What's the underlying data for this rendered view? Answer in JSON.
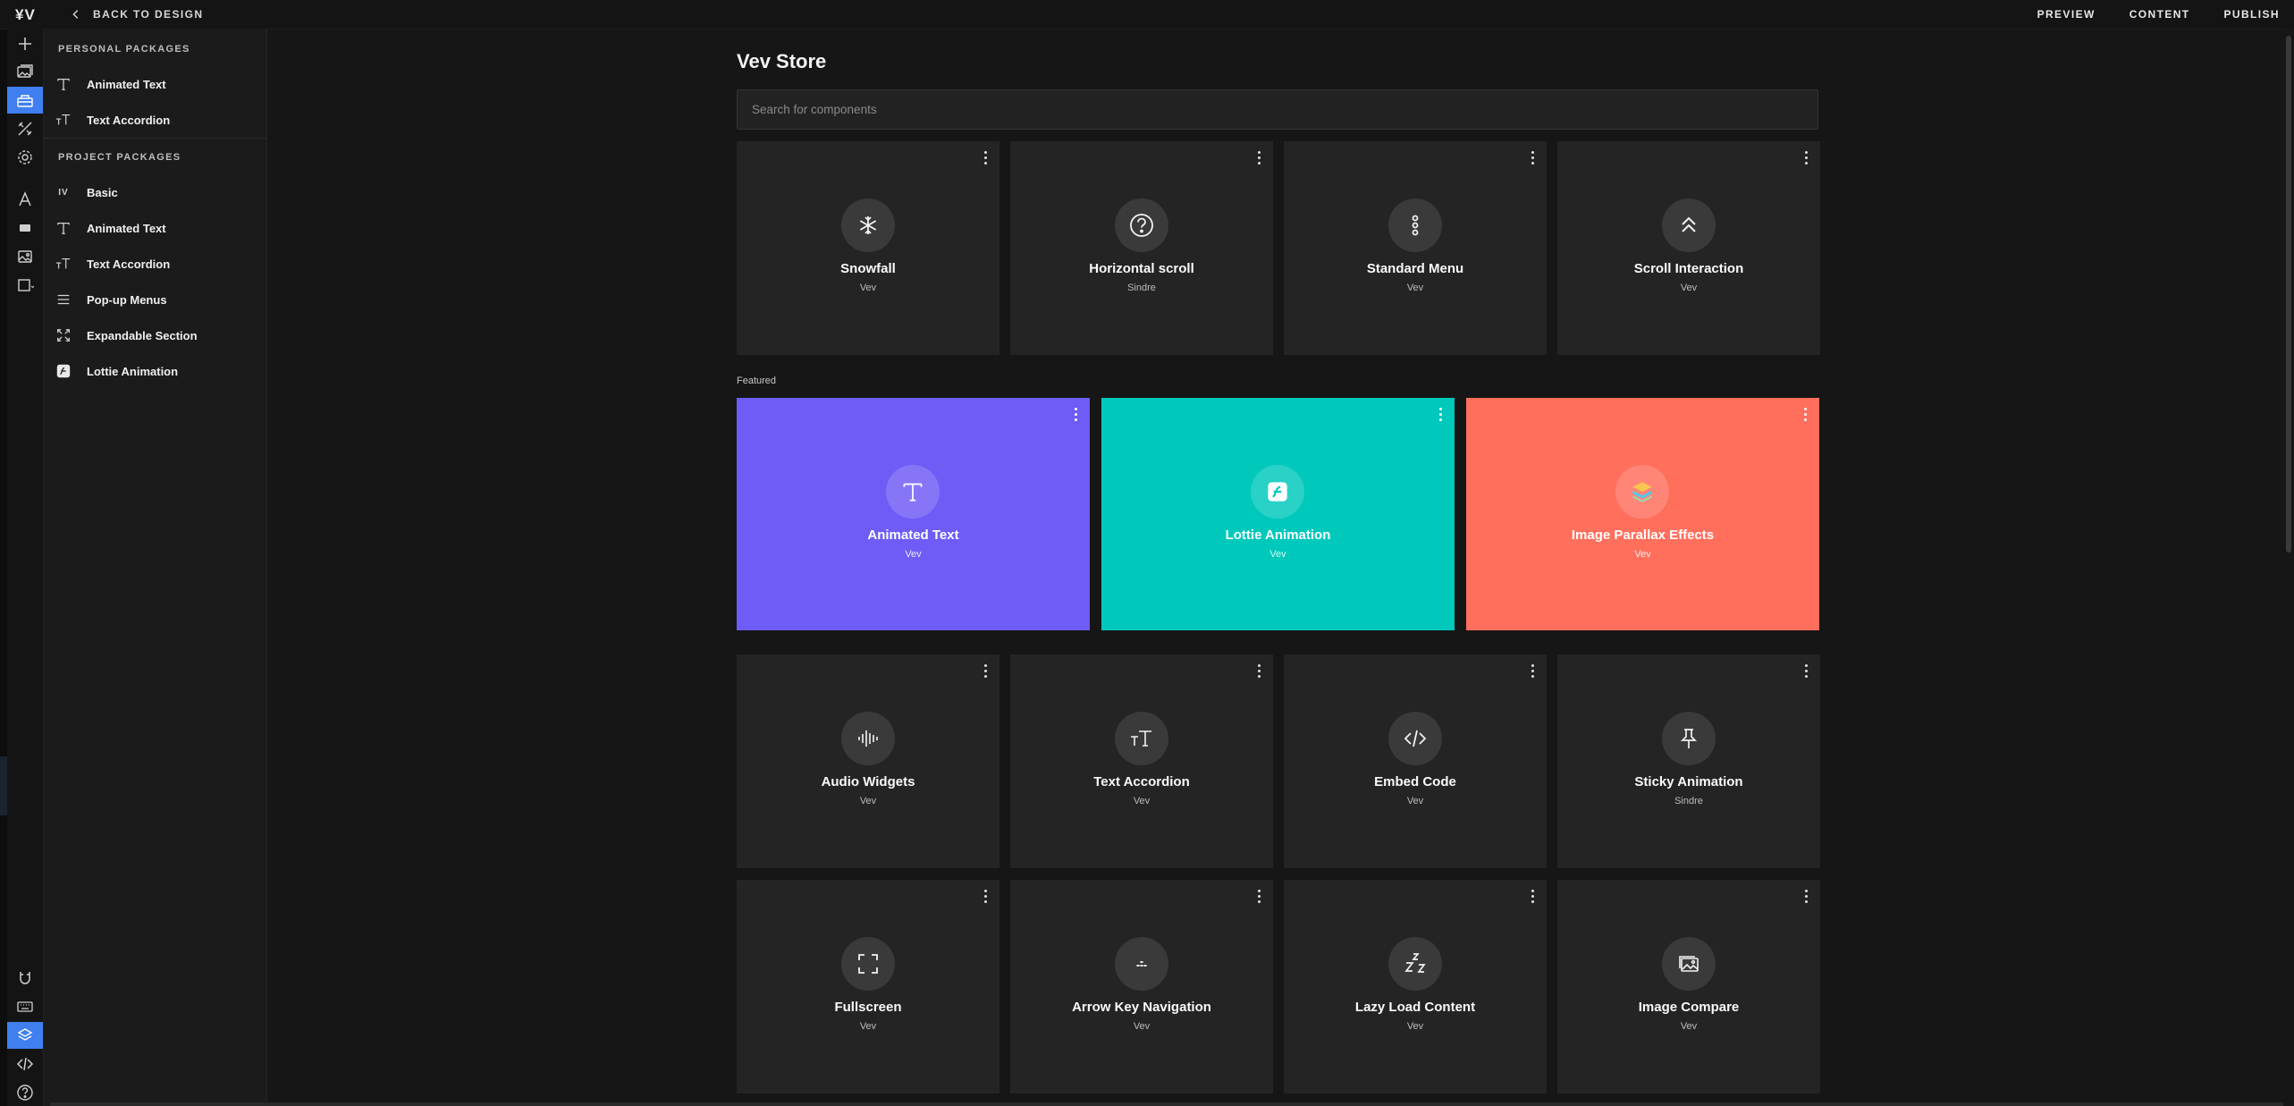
{
  "topbar": {
    "logo": "¥V",
    "back_label": "BACK TO DESIGN",
    "nav": [
      "PREVIEW",
      "CONTENT",
      "PUBLISH"
    ]
  },
  "rail": {
    "top_icons": [
      "plus-icon",
      "image-stack-icon",
      "store-icon",
      "tools-icon",
      "gear-icon",
      "type-icon",
      "block-icon",
      "image-icon",
      "frame-icon"
    ],
    "bottom_icons": [
      "magnet-icon",
      "keyboard-icon",
      "layers-icon",
      "code-icon",
      "help-icon"
    ],
    "active_top": "store-icon",
    "active_bottom": "layers-icon",
    "accent": "#3f7ff0"
  },
  "sidebar": {
    "personal_title": "PERSONAL PACKAGES",
    "personal": [
      {
        "label": "Animated Text",
        "icon": "text-icon"
      },
      {
        "label": "Text Accordion",
        "icon": "text-accordion-icon"
      }
    ],
    "project_title": "PROJECT PACKAGES",
    "project": [
      {
        "label": "Basic",
        "icon": "vev-icon",
        "glyph": "IV"
      },
      {
        "label": "Animated Text",
        "icon": "text-icon"
      },
      {
        "label": "Text Accordion",
        "icon": "text-accordion-icon"
      },
      {
        "label": "Pop-up Menus",
        "icon": "menu-lines-icon"
      },
      {
        "label": "Expandable Section",
        "icon": "expand-icon"
      },
      {
        "label": "Lottie Animation",
        "icon": "lottie-icon"
      }
    ]
  },
  "store": {
    "title": "Vev Store",
    "search_placeholder": "Search for components",
    "top_cards": [
      {
        "title": "Snowfall",
        "author": "Vev",
        "icon": "snowflake-icon"
      },
      {
        "title": "Horizontal scroll",
        "author": "Sindre",
        "icon": "question-icon"
      },
      {
        "title": "Standard Menu",
        "author": "Vev",
        "icon": "vertical-dots-icon"
      },
      {
        "title": "Scroll Interaction",
        "author": "Vev",
        "icon": "double-chevron-up-icon"
      }
    ],
    "featured_label": "Featured",
    "featured": [
      {
        "title": "Animated Text",
        "author": "Vev",
        "icon": "text-icon",
        "color": "#6f5cf6"
      },
      {
        "title": "Lottie Animation",
        "author": "Vev",
        "icon": "lottie-icon",
        "color": "#00c9bb"
      },
      {
        "title": "Image Parallax Effects",
        "author": "Vev",
        "icon": "layers-color-icon",
        "color": "#ff6f5c"
      }
    ],
    "grid_cards": [
      {
        "title": "Audio Widgets",
        "author": "Vev",
        "icon": "audio-wave-icon"
      },
      {
        "title": "Text Accordion",
        "author": "Vev",
        "icon": "text-accordion-icon"
      },
      {
        "title": "Embed Code",
        "author": "Vev",
        "icon": "code-icon"
      },
      {
        "title": "Sticky Animation",
        "author": "Sindre",
        "icon": "pin-icon"
      },
      {
        "title": "Fullscreen",
        "author": "Vev",
        "icon": "fullscreen-icon"
      },
      {
        "title": "Arrow Key Navigation",
        "author": "Vev",
        "icon": "arrow-keys-icon"
      },
      {
        "title": "Lazy Load Content",
        "author": "Vev",
        "icon": "sleep-icon"
      },
      {
        "title": "Image Compare",
        "author": "Vev",
        "icon": "image-compare-icon"
      }
    ]
  }
}
